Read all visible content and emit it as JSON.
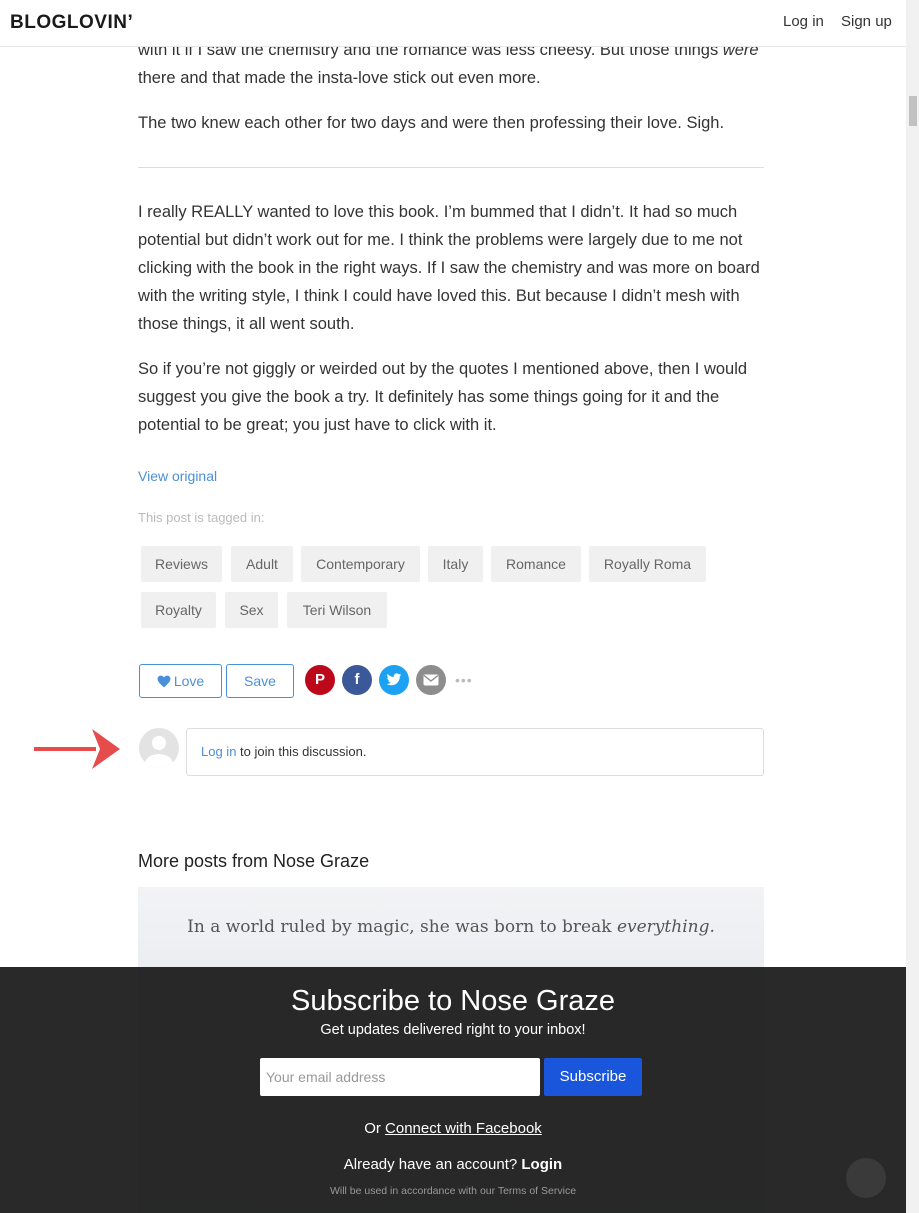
{
  "header": {
    "logo": "BLOGLOVIN’",
    "login": "Log in",
    "signup": "Sign up"
  },
  "article": {
    "paragraphs": [
      "with it if I saw the chemistry and the romance was less cheesy. But those things were there and that made the insta-love stick out even more.",
      "The two knew each other for two days and were then professing their love. Sigh.",
      "I really REALLY wanted to love this book. I’m bummed that I didn’t. It had so much potential but didn’t work out for me. I think the problems were largely due to me not clicking with the book in the right ways. If I saw the chemistry and was more on board with the writing style, I think I could have loved this. But because I didn’t mesh with those things, it all went south.",
      "So if you’re not giggly or weirded out by the quotes I mentioned above, then I would suggest you give the book a try. It definitely has some things going for it and the potential to be great; you just have to click with it."
    ],
    "p0_before": "with it if I saw the chemistry and the romance was less cheesy. But those things ",
    "p0_em": "were",
    "p0_after": " there and that made the insta-love stick out even more.",
    "view_original": "View original",
    "tagged_label": "This post is tagged in:",
    "tags": [
      "Reviews",
      "Adult",
      "Contemporary",
      "Italy",
      "Romance",
      "Royally Roma",
      "Royalty",
      "Sex",
      "Teri Wilson"
    ]
  },
  "actions": {
    "love": "Love",
    "save": "Save",
    "pinterest": "P",
    "facebook": "f",
    "more": "•••"
  },
  "comment": {
    "link": "Log in",
    "text": " to join this discussion."
  },
  "more_posts": {
    "heading": "More posts from Nose Graze",
    "image_text_before": "In a world ruled by magic, she was born to break ",
    "image_text_em": "everything."
  },
  "subscribe": {
    "title": "Subscribe to Nose Graze",
    "subtitle": "Get updates delivered right to your inbox!",
    "email_placeholder": "Your email address",
    "button": "Subscribe",
    "fb_prefix": "Or ",
    "fb_link": "Connect with Facebook",
    "account_prefix": "Already have an account? ",
    "account_link": "Login",
    "terms": "Will be used in accordance with our Terms of Service"
  },
  "colors": {
    "link": "#4a90d9",
    "pinterest": "#bd081c",
    "facebook": "#3b5998",
    "twitter": "#1da1f2",
    "subscribe_button": "#1a56db",
    "arrow": "#e74c4c"
  }
}
